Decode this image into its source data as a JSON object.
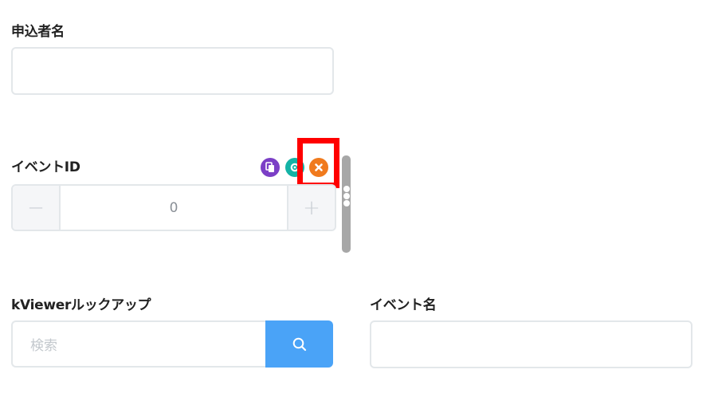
{
  "fields": {
    "applicant_name": {
      "label": "申込者名",
      "value": ""
    },
    "event_id": {
      "label": "イベントID",
      "value": "0",
      "minus": "−",
      "plus": "+"
    },
    "kviewer_lookup": {
      "label": "kViewerルックアップ",
      "placeholder": "検索"
    },
    "event_name": {
      "label": "イベント名",
      "value": ""
    }
  },
  "field_tools": {
    "icons": [
      "copy-icon",
      "settings-icon",
      "delete-icon"
    ],
    "colors": {
      "copy": "#7b3fc6",
      "settings": "#14b3a6",
      "delete": "#f07a1d"
    }
  },
  "highlight_color": "#ff0000",
  "accent_color": "#4aa3f7"
}
